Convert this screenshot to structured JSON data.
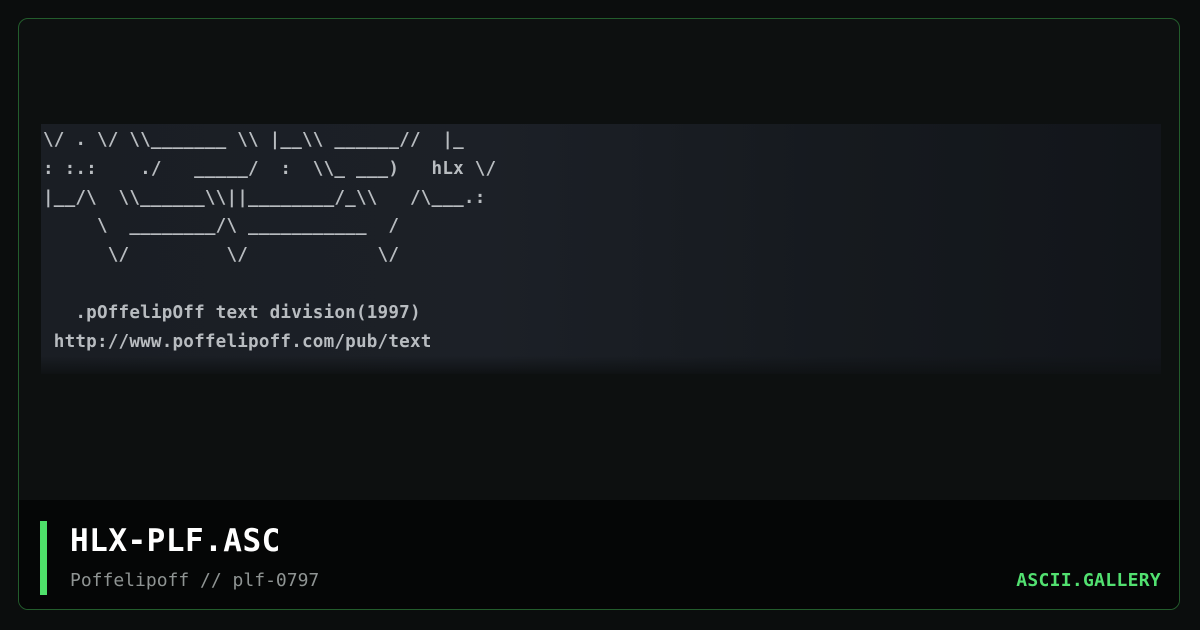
{
  "art": {
    "text": "\\/ . \\/ \\\\_______ \\\\ |__\\\\ ______//  |_\n: :.:    ./   _____/  :  \\\\_ ___)   hLx \\/\n|__/\\  \\\\______\\\\||________/_\\\\   /\\___.:\n     \\  ________/\\ ___________  /\n      \\/         \\/            \\/\n\n   .pOffelipOff text division(1997)\n http://www.poffelipoff.com/pub/text"
  },
  "footer": {
    "title": "HLX-PLF.ASC",
    "subtitle": "Poffelipoff // plf-0797",
    "brand": "ASCII.GALLERY"
  },
  "colors": {
    "accent": "#4ee06a",
    "frame_border": "#235c2c",
    "background": "#0b0d0d",
    "art_text": "#b8bcc0"
  }
}
